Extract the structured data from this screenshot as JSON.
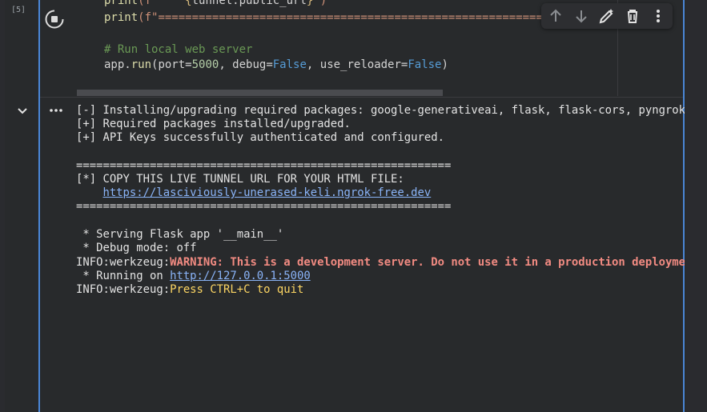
{
  "cell": {
    "execution_count": "[5]"
  },
  "code": {
    "line1": {
      "fn": "print",
      "open": "(f\"",
      "pad": "    ",
      "brace_open": "{",
      "var": "tunnel.public_url",
      "brace_close": "}",
      "close": "\")"
    },
    "line2": {
      "fn": "print",
      "open": "(f\"",
      "equals": "=========================================================\\"
    },
    "comment": "# Run local web server",
    "run": {
      "prefix": "app.",
      "fn": "run",
      "open": "(port=",
      "port": "5000",
      "sep": ", debug=",
      "debug": "False",
      "sep2": ", use_reloader=",
      "reloader": "False",
      "close": ")"
    }
  },
  "toolbar": {
    "icons": [
      "arrow-up-icon",
      "arrow-down-icon",
      "edit-pencil-icon",
      "delete-icon",
      "more-vert-icon"
    ]
  },
  "output": {
    "line1": "[-] Installing/upgrading required packages: google-generativeai, flask, flask-cors, pyngrok",
    "line2": "[+] Required packages installed/upgraded.",
    "line3": "[+] API Keys successfully authenticated and configured.",
    "separator": "========================================================",
    "copy_line": "[*] COPY THIS LIVE TUNNEL URL FOR YOUR HTML FILE:",
    "tunnel_indent": "    ",
    "tunnel_url": "https://lasciviously-unerased-keli.ngrok-free.dev",
    "serving": " * Serving Flask app '__main__'",
    "debug_mode": " * Debug mode: off",
    "info_prefix": "INFO:werkzeug:",
    "warning": "WARNING: This is a development server. Do not use it in a production deployment.",
    "running_prefix": " * Running on ",
    "local_url": "http://127.0.0.1:5000",
    "quit_msg": "Press CTRL+C to quit"
  },
  "colors": {
    "accent": "#4a86d6",
    "link": "#8ab4f8",
    "warning": "#f28b82",
    "highlight": "#fdd663"
  }
}
